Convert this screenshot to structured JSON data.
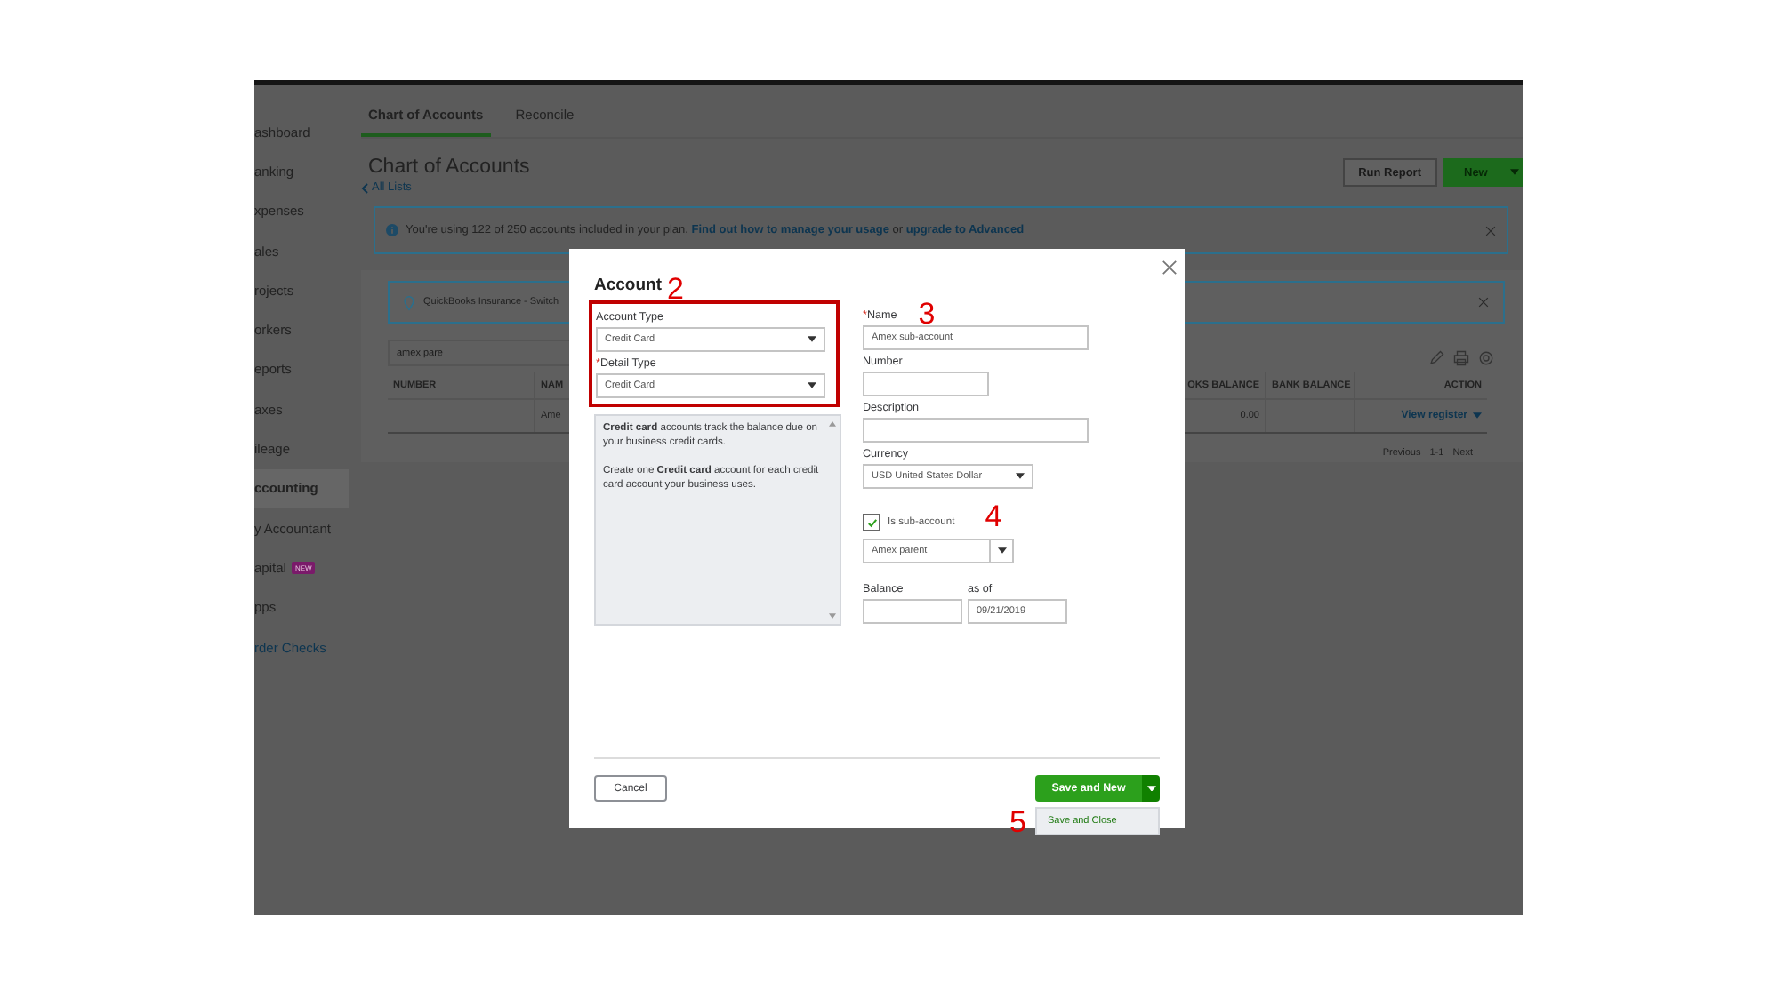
{
  "sidebar": {
    "items": [
      {
        "label": "ashboard",
        "kind": "page",
        "selected": false
      },
      {
        "label": "anking",
        "kind": "page",
        "selected": false
      },
      {
        "label": "xpenses",
        "kind": "page",
        "selected": false
      },
      {
        "label": "ales",
        "kind": "page",
        "selected": false
      },
      {
        "label": "rojects",
        "kind": "page",
        "selected": false
      },
      {
        "label": "orkers",
        "kind": "page",
        "selected": false
      },
      {
        "label": "eports",
        "kind": "page",
        "selected": false
      },
      {
        "label": "axes",
        "kind": "page",
        "selected": false
      },
      {
        "label": "ileage",
        "kind": "page",
        "selected": false
      },
      {
        "label": "ccounting",
        "kind": "page",
        "selected": true
      },
      {
        "label": "y Accountant",
        "kind": "page",
        "selected": false
      },
      {
        "label": "apital",
        "kind": "page",
        "selected": false,
        "badge": "NEW"
      },
      {
        "label": "pps",
        "kind": "page",
        "selected": false
      },
      {
        "label": "rder Checks",
        "kind": "link",
        "selected": false
      }
    ]
  },
  "tabs": [
    {
      "label": "Chart of Accounts",
      "selected": true
    },
    {
      "label": "Reconcile",
      "selected": false
    }
  ],
  "page": {
    "title": "Chart of Accounts",
    "back_link": "All Lists",
    "run_report": "Run Report",
    "new": "New"
  },
  "notice": {
    "lead": "You're using 122 of 250 accounts included in your plan.",
    "link_1": "Find out how to manage your usage",
    "joiner": "or",
    "link_2": "upgrade to Advanced"
  },
  "insurance_banner": {
    "text": "QuickBooks Insurance - Switch"
  },
  "search": {
    "value": "amex pare"
  },
  "table": {
    "columns": [
      "NUMBER",
      "NAM",
      "OKS BALANCE",
      "BANK BALANCE",
      "ACTION"
    ],
    "rows": [
      {
        "name": "Ame",
        "balance": "0.00",
        "action": "View register"
      }
    ]
  },
  "pagination": {
    "previous": "Previous",
    "range": "1-1",
    "next": "Next"
  },
  "dialog": {
    "title": "Account",
    "required_mark": "*",
    "account_type": {
      "label": "Account Type",
      "required": false,
      "value": "Credit Card"
    },
    "detail_type": {
      "label": "Detail Type",
      "required": true,
      "value": "Credit Card"
    },
    "help": [
      "**Credit card** accounts track the balance due on your business credit cards.",
      "Create one **Credit card** account for each credit card account your business uses."
    ],
    "name": {
      "label": "Name",
      "required": true,
      "value": "Amex sub-account"
    },
    "number": {
      "label": "Number"
    },
    "description": {
      "label": "Description"
    },
    "currency": {
      "label": "Currency",
      "value": "USD United States Dollar"
    },
    "sub_account": {
      "label": "Is sub-account",
      "checked": true,
      "parent": "Amex parent"
    },
    "balance": {
      "label": "Balance"
    },
    "as_of": {
      "label": "as of",
      "value": "09/21/2019"
    },
    "cancel": "Cancel",
    "save": "Save and New",
    "menu": [
      {
        "label": "Save and Close"
      }
    ],
    "annotations": [
      "2",
      "3",
      "4",
      "5"
    ]
  }
}
